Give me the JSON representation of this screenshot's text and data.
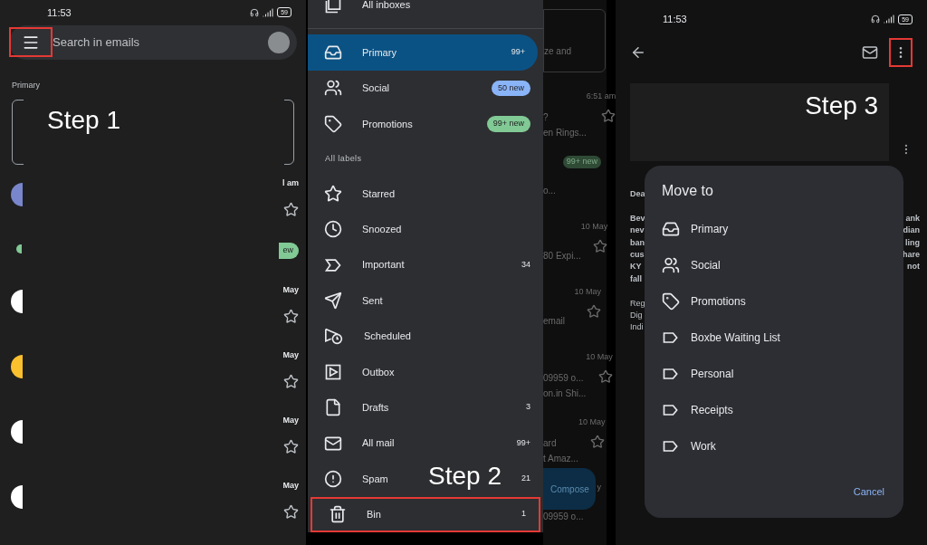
{
  "panel_1": {
    "status_bar": {
      "time": "11:53",
      "battery": "59"
    },
    "search": {
      "placeholder": "Search in emails",
      "menu_highlighted": true
    },
    "section_label": "Primary",
    "step_label": "Step 1",
    "rows": [
      {
        "kind": "mail",
        "color": "#7986cb",
        "time": "l am",
        "starred": false
      },
      {
        "kind": "promo",
        "color": "#81c995",
        "badge": "ew"
      },
      {
        "kind": "mail",
        "color": "#ffffff",
        "time": "May",
        "starred": false
      },
      {
        "kind": "mail",
        "color": "#fbc02d",
        "time": "May",
        "starred": false
      },
      {
        "kind": "mail",
        "color": "#ffffff",
        "time": "May",
        "starred": false
      },
      {
        "kind": "mail",
        "color": "#ffffff",
        "time": "May",
        "starred": false
      }
    ]
  },
  "panel_2": {
    "drawer": [
      {
        "kind": "all",
        "label": "All inboxes",
        "selected": false,
        "highlighted": false
      },
      {
        "kind": "divider"
      },
      {
        "kind": "inbox",
        "label": "Primary",
        "count": "99+",
        "selected": true,
        "highlighted": false
      },
      {
        "kind": "social",
        "label": "Social",
        "badge": "50 new",
        "color": "#8ab4f8",
        "selected": false,
        "highlighted": false
      },
      {
        "kind": "tag",
        "label": "Promotions",
        "badge": "99+ new",
        "color": "#81c995",
        "selected": false,
        "highlighted": false
      },
      {
        "kind": "heading",
        "label": "All labels"
      },
      {
        "kind": "star",
        "label": "Starred",
        "selected": false,
        "highlighted": false
      },
      {
        "kind": "clock",
        "label": "Snoozed",
        "selected": false,
        "highlighted": false
      },
      {
        "kind": "important",
        "label": "Important",
        "count": "34",
        "selected": false,
        "highlighted": false
      },
      {
        "kind": "send",
        "label": "Sent",
        "selected": false,
        "highlighted": false
      },
      {
        "kind": "scheduled",
        "label": "Scheduled",
        "selected": false,
        "highlighted": false
      },
      {
        "kind": "outbox",
        "label": "Outbox",
        "selected": false,
        "highlighted": false
      },
      {
        "kind": "file",
        "label": "Drafts",
        "count": "3",
        "selected": false,
        "highlighted": false
      },
      {
        "kind": "allmail",
        "label": "All mail",
        "count": "99+",
        "selected": false,
        "highlighted": false
      },
      {
        "kind": "spam",
        "label": "Spam",
        "step_label": "Step 2",
        "count": "21",
        "selected": false,
        "highlighted": false
      },
      {
        "kind": "bin",
        "label": "Bin",
        "count": "1",
        "selected": false,
        "highlighted": true
      }
    ],
    "background": {
      "card_text": "ze and",
      "rows": [
        {
          "time": "6:51 am",
          "lines": [
            "?",
            "en Rings..."
          ],
          "starred": false
        },
        {
          "badge": "99+ new",
          "lines": [
            "o..."
          ]
        },
        {
          "time": "10 May",
          "lines": [
            "80 Expi..."
          ],
          "starred": false
        },
        {
          "time": "10 May",
          "lines": [
            "email"
          ],
          "starred": false
        },
        {
          "time": "10 May",
          "lines": [
            "09959 o...",
            "on.in Shi..."
          ],
          "starred": false
        },
        {
          "time": "10 May",
          "lines": [
            "ard",
            "t Amaz..."
          ],
          "starred": false
        },
        {
          "time": "y",
          "lines": [
            "09959 o..."
          ]
        }
      ],
      "compose": "Compose"
    }
  },
  "panel_3": {
    "status_bar": {
      "time": "11:53",
      "battery": "59"
    },
    "more_highlighted": true,
    "step_label": "Step 3",
    "greeting": "Dea",
    "paragraph_left": [
      "Bev",
      "nev",
      "ban",
      "cus",
      "KY",
      "fall"
    ],
    "paragraph_right": [
      "ank",
      "dian",
      "ling",
      "hare",
      "not"
    ],
    "signature": [
      "Reg",
      "Dig",
      "Indi"
    ],
    "dialog": {
      "title": "Move to",
      "items": [
        {
          "kind": "inbox",
          "label": "Primary"
        },
        {
          "kind": "social",
          "label": "Social"
        },
        {
          "kind": "tag",
          "label": "Promotions"
        },
        {
          "kind": "label",
          "label": "Boxbe Waiting List"
        },
        {
          "kind": "label",
          "label": "Personal"
        },
        {
          "kind": "label",
          "label": "Receipts"
        },
        {
          "kind": "label",
          "label": "Work"
        }
      ],
      "cancel": "Cancel"
    }
  }
}
